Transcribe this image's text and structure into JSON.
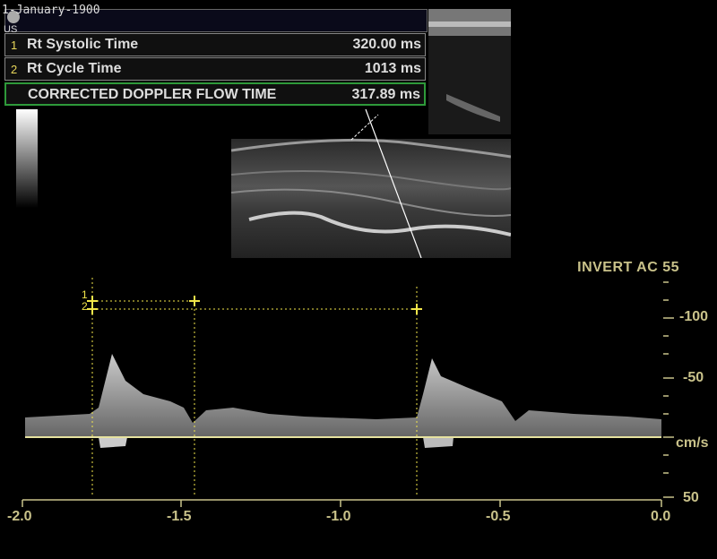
{
  "header": {
    "date": "1-January-1900",
    "mode_tag": "US"
  },
  "measurements": [
    {
      "index": "1",
      "label": "Rt  Systolic Time",
      "value": "320.00 ms"
    },
    {
      "index": "2",
      "label": "Rt  Cycle Time",
      "value": "1013 ms"
    },
    {
      "index": "",
      "label": "CORRECTED DOPPLER FLOW TIME",
      "value": "317.89 ms"
    }
  ],
  "doppler": {
    "mode_info": "INVERT   AC 55",
    "y_labels": [
      "-100",
      "-50",
      "cm/s",
      "50"
    ],
    "x_labels": [
      "-2.0",
      "-1.5",
      "-1.0",
      "-0.5",
      "0.0"
    ],
    "x_range": [
      -2.0,
      0.0
    ],
    "calipers": [
      "1",
      "2"
    ]
  },
  "colors": {
    "scale": "#c9c28a",
    "caliper": "#f2e64a",
    "highlight_box": "#2e9a3a"
  }
}
